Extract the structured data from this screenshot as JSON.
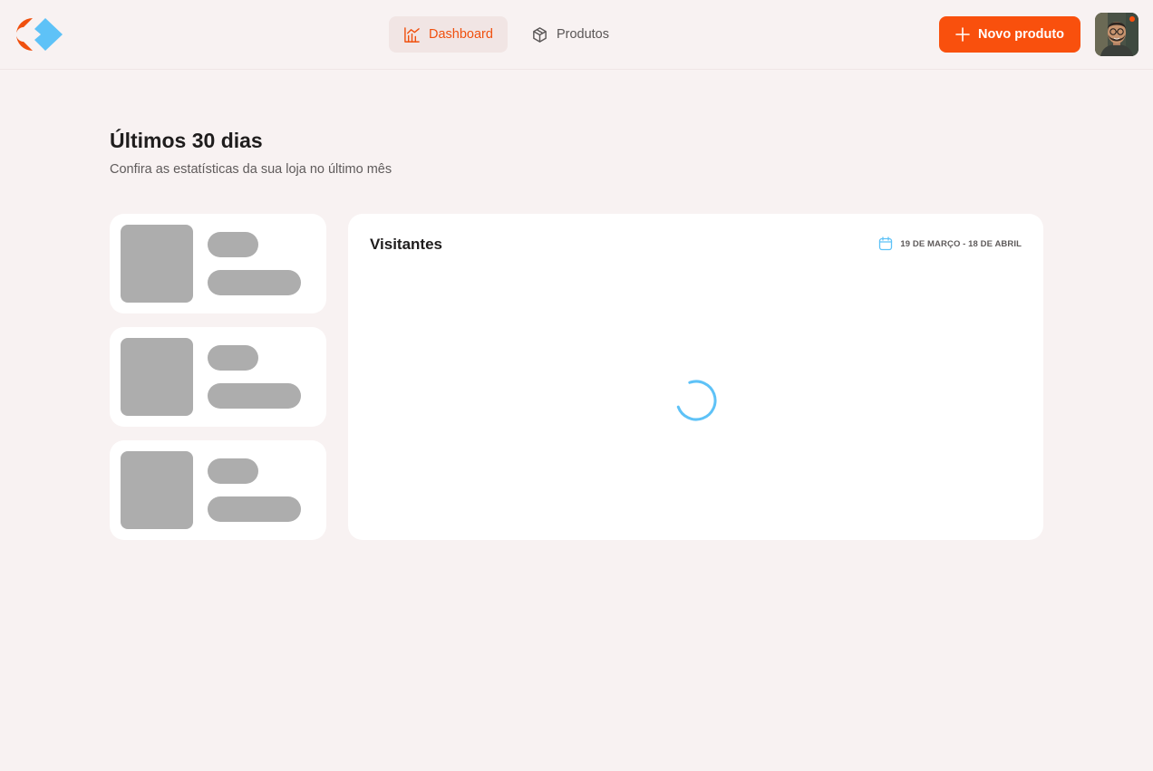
{
  "header": {
    "nav": [
      {
        "label": "Dashboard",
        "icon": "chart-icon",
        "active": true
      },
      {
        "label": "Produtos",
        "icon": "box-icon",
        "active": false
      }
    ],
    "new_button_label": "Novo produto",
    "avatar_alt": "Foto do usuário"
  },
  "main": {
    "title": "Últimos 30 dias",
    "subtitle": "Confira as estatísticas da sua loja no último mês"
  },
  "visitors": {
    "title": "Visitantes",
    "date_range": "19 DE MARÇO - 18 DE ABRIL",
    "loading": true
  },
  "colors": {
    "accent": "#f9500d",
    "secondary": "#5ec2f7",
    "background": "#f8f2f2",
    "skeleton": "#adadad"
  }
}
